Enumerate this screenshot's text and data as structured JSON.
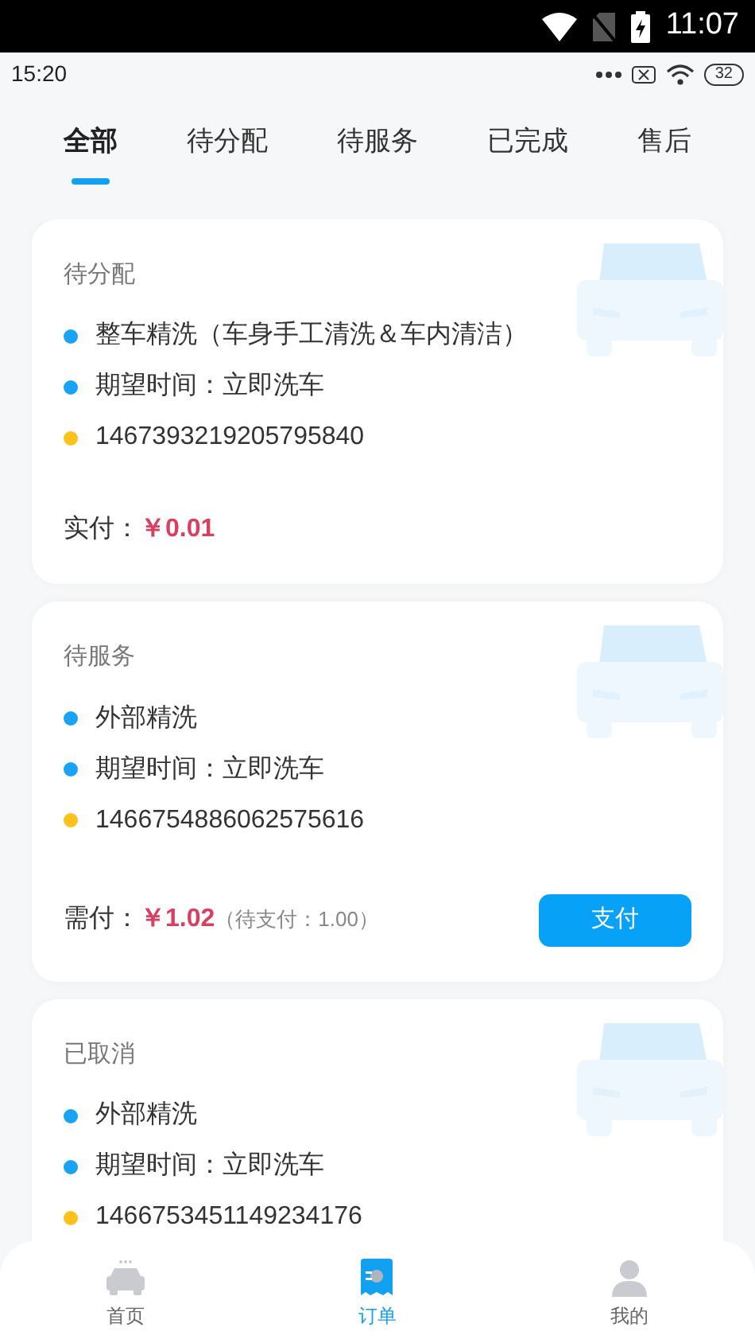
{
  "system_bar": {
    "time": "11:07"
  },
  "status_bar": {
    "time": "15:20",
    "battery": "32"
  },
  "tabs": [
    {
      "label": "全部",
      "selected": true
    },
    {
      "label": "待分配",
      "selected": false
    },
    {
      "label": "待服务",
      "selected": false
    },
    {
      "label": "已完成",
      "selected": false
    },
    {
      "label": "售后",
      "selected": false
    }
  ],
  "orders": [
    {
      "status": "待分配",
      "lines": [
        {
          "text": "整车精洗（车身手工清洗＆车内清洁）",
          "color": "#1aa3f5"
        },
        {
          "text": "期望时间：立即洗车",
          "color": "#1aa3f5"
        },
        {
          "text": "1467393219205795840",
          "color": "#fcc21b"
        }
      ],
      "price_label": "实付：",
      "price": "￥0.01"
    },
    {
      "status": "待服务",
      "lines": [
        {
          "text": "外部精洗",
          "color": "#1aa3f5"
        },
        {
          "text": "期望时间：立即洗车",
          "color": "#1aa3f5"
        },
        {
          "text": "1466754886062575616",
          "color": "#fcc21b"
        }
      ],
      "price_label": "需付：",
      "price": "￥1.02",
      "price_note": "（待支付：1.00）",
      "action": "支付"
    },
    {
      "status": "已取消",
      "lines": [
        {
          "text": "外部精洗",
          "color": "#1aa3f5"
        },
        {
          "text": "期望时间：立即洗车",
          "color": "#1aa3f5"
        },
        {
          "text": "1466753451149234176",
          "color": "#fcc21b"
        }
      ]
    }
  ],
  "bottom_nav": [
    {
      "label": "首页",
      "selected": false,
      "kind": "car"
    },
    {
      "label": "订单",
      "selected": true,
      "kind": "orders"
    },
    {
      "label": "我的",
      "selected": false,
      "kind": "person"
    }
  ]
}
